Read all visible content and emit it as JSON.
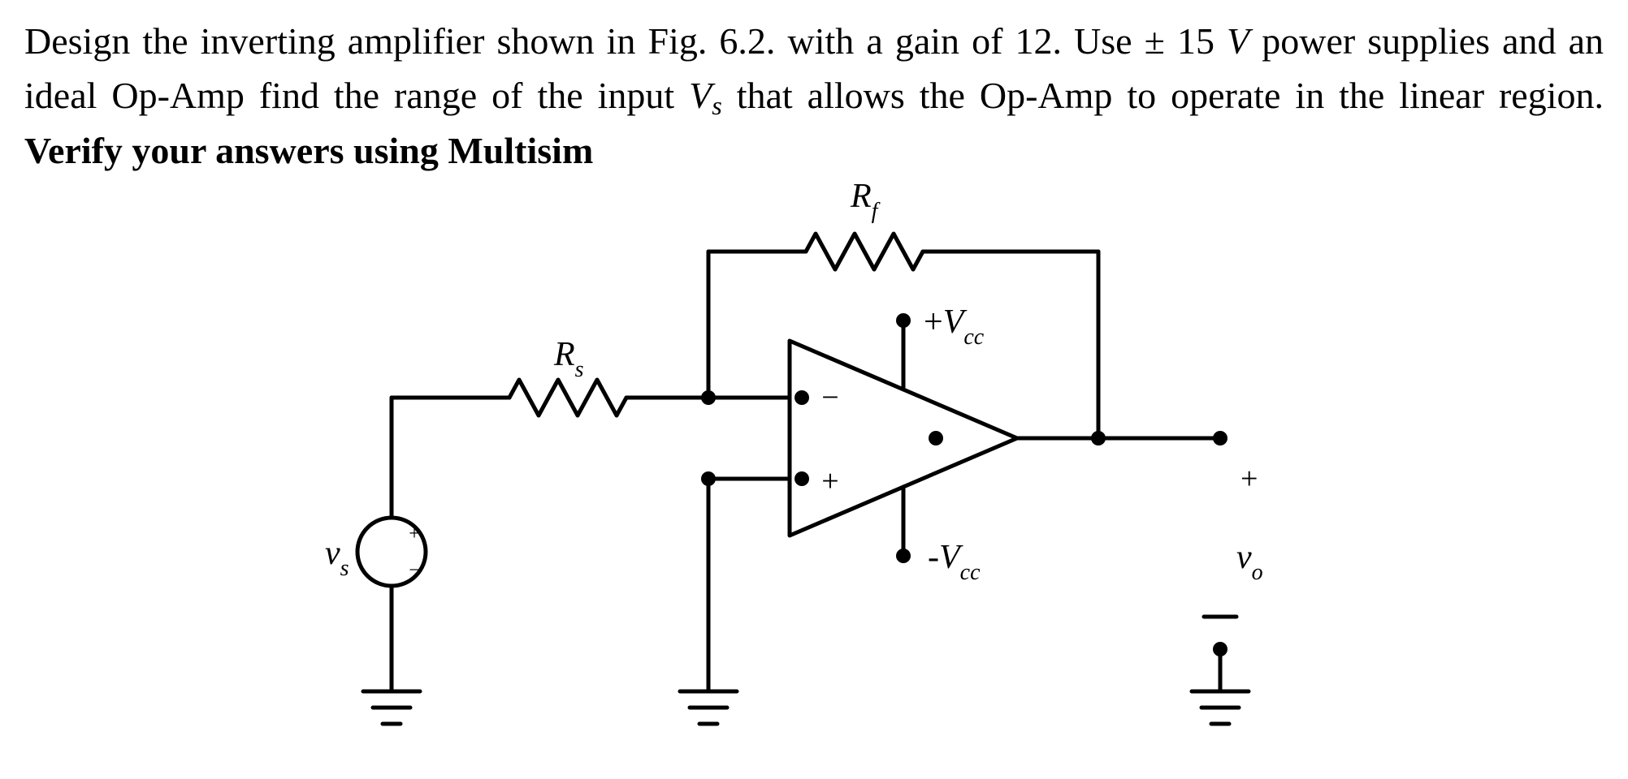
{
  "problem": {
    "prefix": "Design the inverting amplifier shown in Fig. 6.2. with a gain of 12. Use ± 15 ",
    "unit_v": "V",
    "mid1": " power supplies and an ideal Op-Amp find the range of the input ",
    "vs_sym": "V",
    "vs_sub": "s",
    "mid2": " that allows the Op-Amp to operate in the linear region. ",
    "bold": "Verify your answers using Multisim"
  },
  "labels": {
    "Rf": "R",
    "Rf_sub": "f",
    "Rs": "R",
    "Rs_sub": "s",
    "plusVcc_pre": "+",
    "Vcc": "V",
    "Vcc_sub": "cc",
    "minusVcc_pre": "-",
    "vs": "v",
    "vs_sub": "s",
    "vo": "v",
    "vo_sub": "o",
    "plus": "+",
    "minus": "−",
    "src_plus": "+",
    "src_minus": "−"
  }
}
